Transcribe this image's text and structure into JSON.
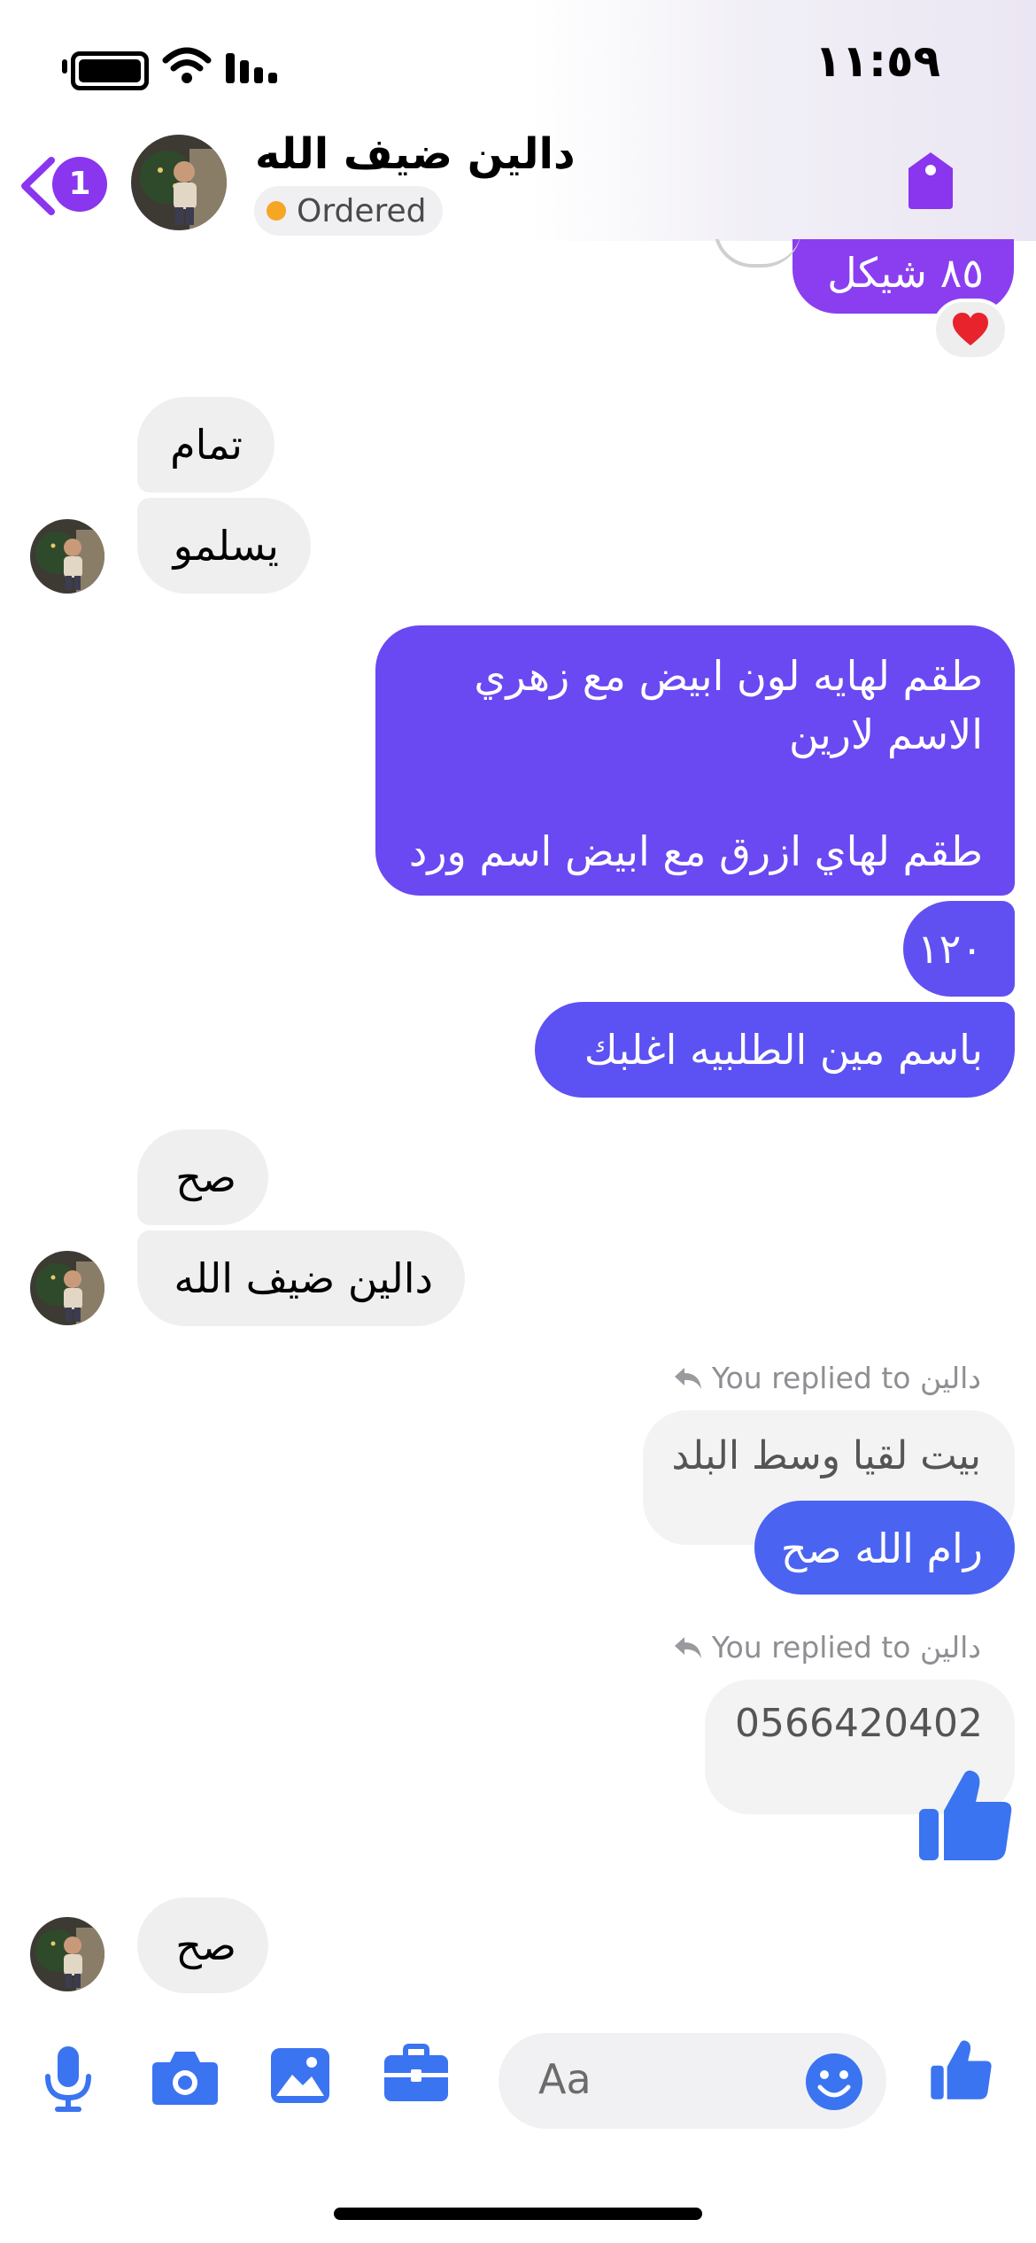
{
  "status_bar": {
    "time": "١١:٥٩"
  },
  "header": {
    "back_badge_count": "1",
    "contact_name": "دالين ضيف الله",
    "order_status": "Ordered"
  },
  "messages": {
    "top_price": "٨٥ شيكل",
    "reaction_emoji": "heart",
    "in_1": "تمام",
    "in_2": "يسلمو",
    "out_1_line1": "طقم لهايه لون ابيض مع زهري",
    "out_1_line2": "الاسم لارين",
    "out_1_line3": "طقم لهاي ازرق مع ابيض اسم ورد",
    "out_2": "١٢٠",
    "out_3": "باسم مين الطلبيه اغلبك",
    "in_3": "صح",
    "in_4": "دالين ضيف الله",
    "reply_1_label": "You replied to دالين",
    "reply_1_quote": "بيت لقيا  وسط البلد",
    "out_4": "رام الله صح",
    "reply_2_label": "You replied to دالين",
    "reply_2_quote": "0566420402",
    "in_5": "صح"
  },
  "composer": {
    "placeholder": "Aa"
  },
  "colors": {
    "accent_purple": "#8a35ee",
    "bubble_purple": "#7e45f0",
    "bubble_indigo": "#5c51f2",
    "bubble_blue": "#4a63f1",
    "messenger_blue": "#3b74f1",
    "incoming_gray": "#efefef"
  }
}
